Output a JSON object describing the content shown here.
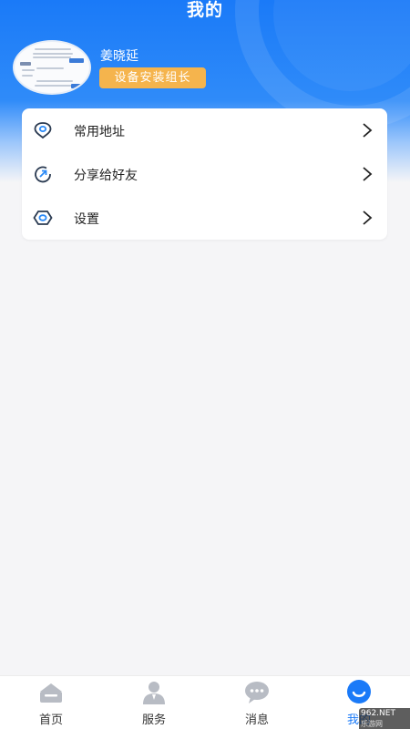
{
  "header": {
    "title": "我的",
    "background_color": "#1a7af8"
  },
  "profile": {
    "name": "姜晓延",
    "role": "设备安装组长",
    "role_color": "#f5b44d"
  },
  "menu": [
    {
      "label": "常用地址",
      "icon": "location-pin-icon"
    },
    {
      "label": "分享给好友",
      "icon": "share-icon"
    },
    {
      "label": "设置",
      "icon": "settings-hexagon-icon"
    }
  ],
  "tabbar": {
    "active_color": "#1a7af8",
    "tabs": [
      {
        "label": "首页",
        "icon": "home-icon",
        "active": false
      },
      {
        "label": "服务",
        "icon": "service-person-icon",
        "active": false
      },
      {
        "label": "消息",
        "icon": "message-bubble-icon",
        "active": false
      },
      {
        "label": "我的",
        "icon": "profile-smile-icon",
        "active": true
      }
    ]
  },
  "watermark": {
    "brand": "962.NET",
    "sub": "乐游网"
  }
}
